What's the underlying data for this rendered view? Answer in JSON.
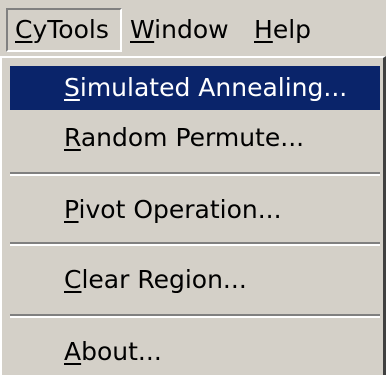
{
  "menubar": {
    "items": [
      {
        "pre": "",
        "key": "C",
        "post": "yTools"
      },
      {
        "pre": "",
        "key": "W",
        "post": "indow"
      },
      {
        "pre": "",
        "key": "H",
        "post": "elp"
      }
    ]
  },
  "menu": {
    "items": [
      {
        "pre": "",
        "key": "S",
        "post": "imulated Annealing..."
      },
      {
        "pre": "",
        "key": "R",
        "post": "andom Permute..."
      },
      {
        "pre": "",
        "key": "P",
        "post": "ivot Operation..."
      },
      {
        "pre": "",
        "key": "C",
        "post": "lear Region..."
      },
      {
        "pre": "",
        "key": "A",
        "post": "bout..."
      }
    ]
  },
  "colors": {
    "menu_background": "#d4d0c8",
    "selection_background": "#0a246a",
    "selection_text": "#ffffff"
  }
}
